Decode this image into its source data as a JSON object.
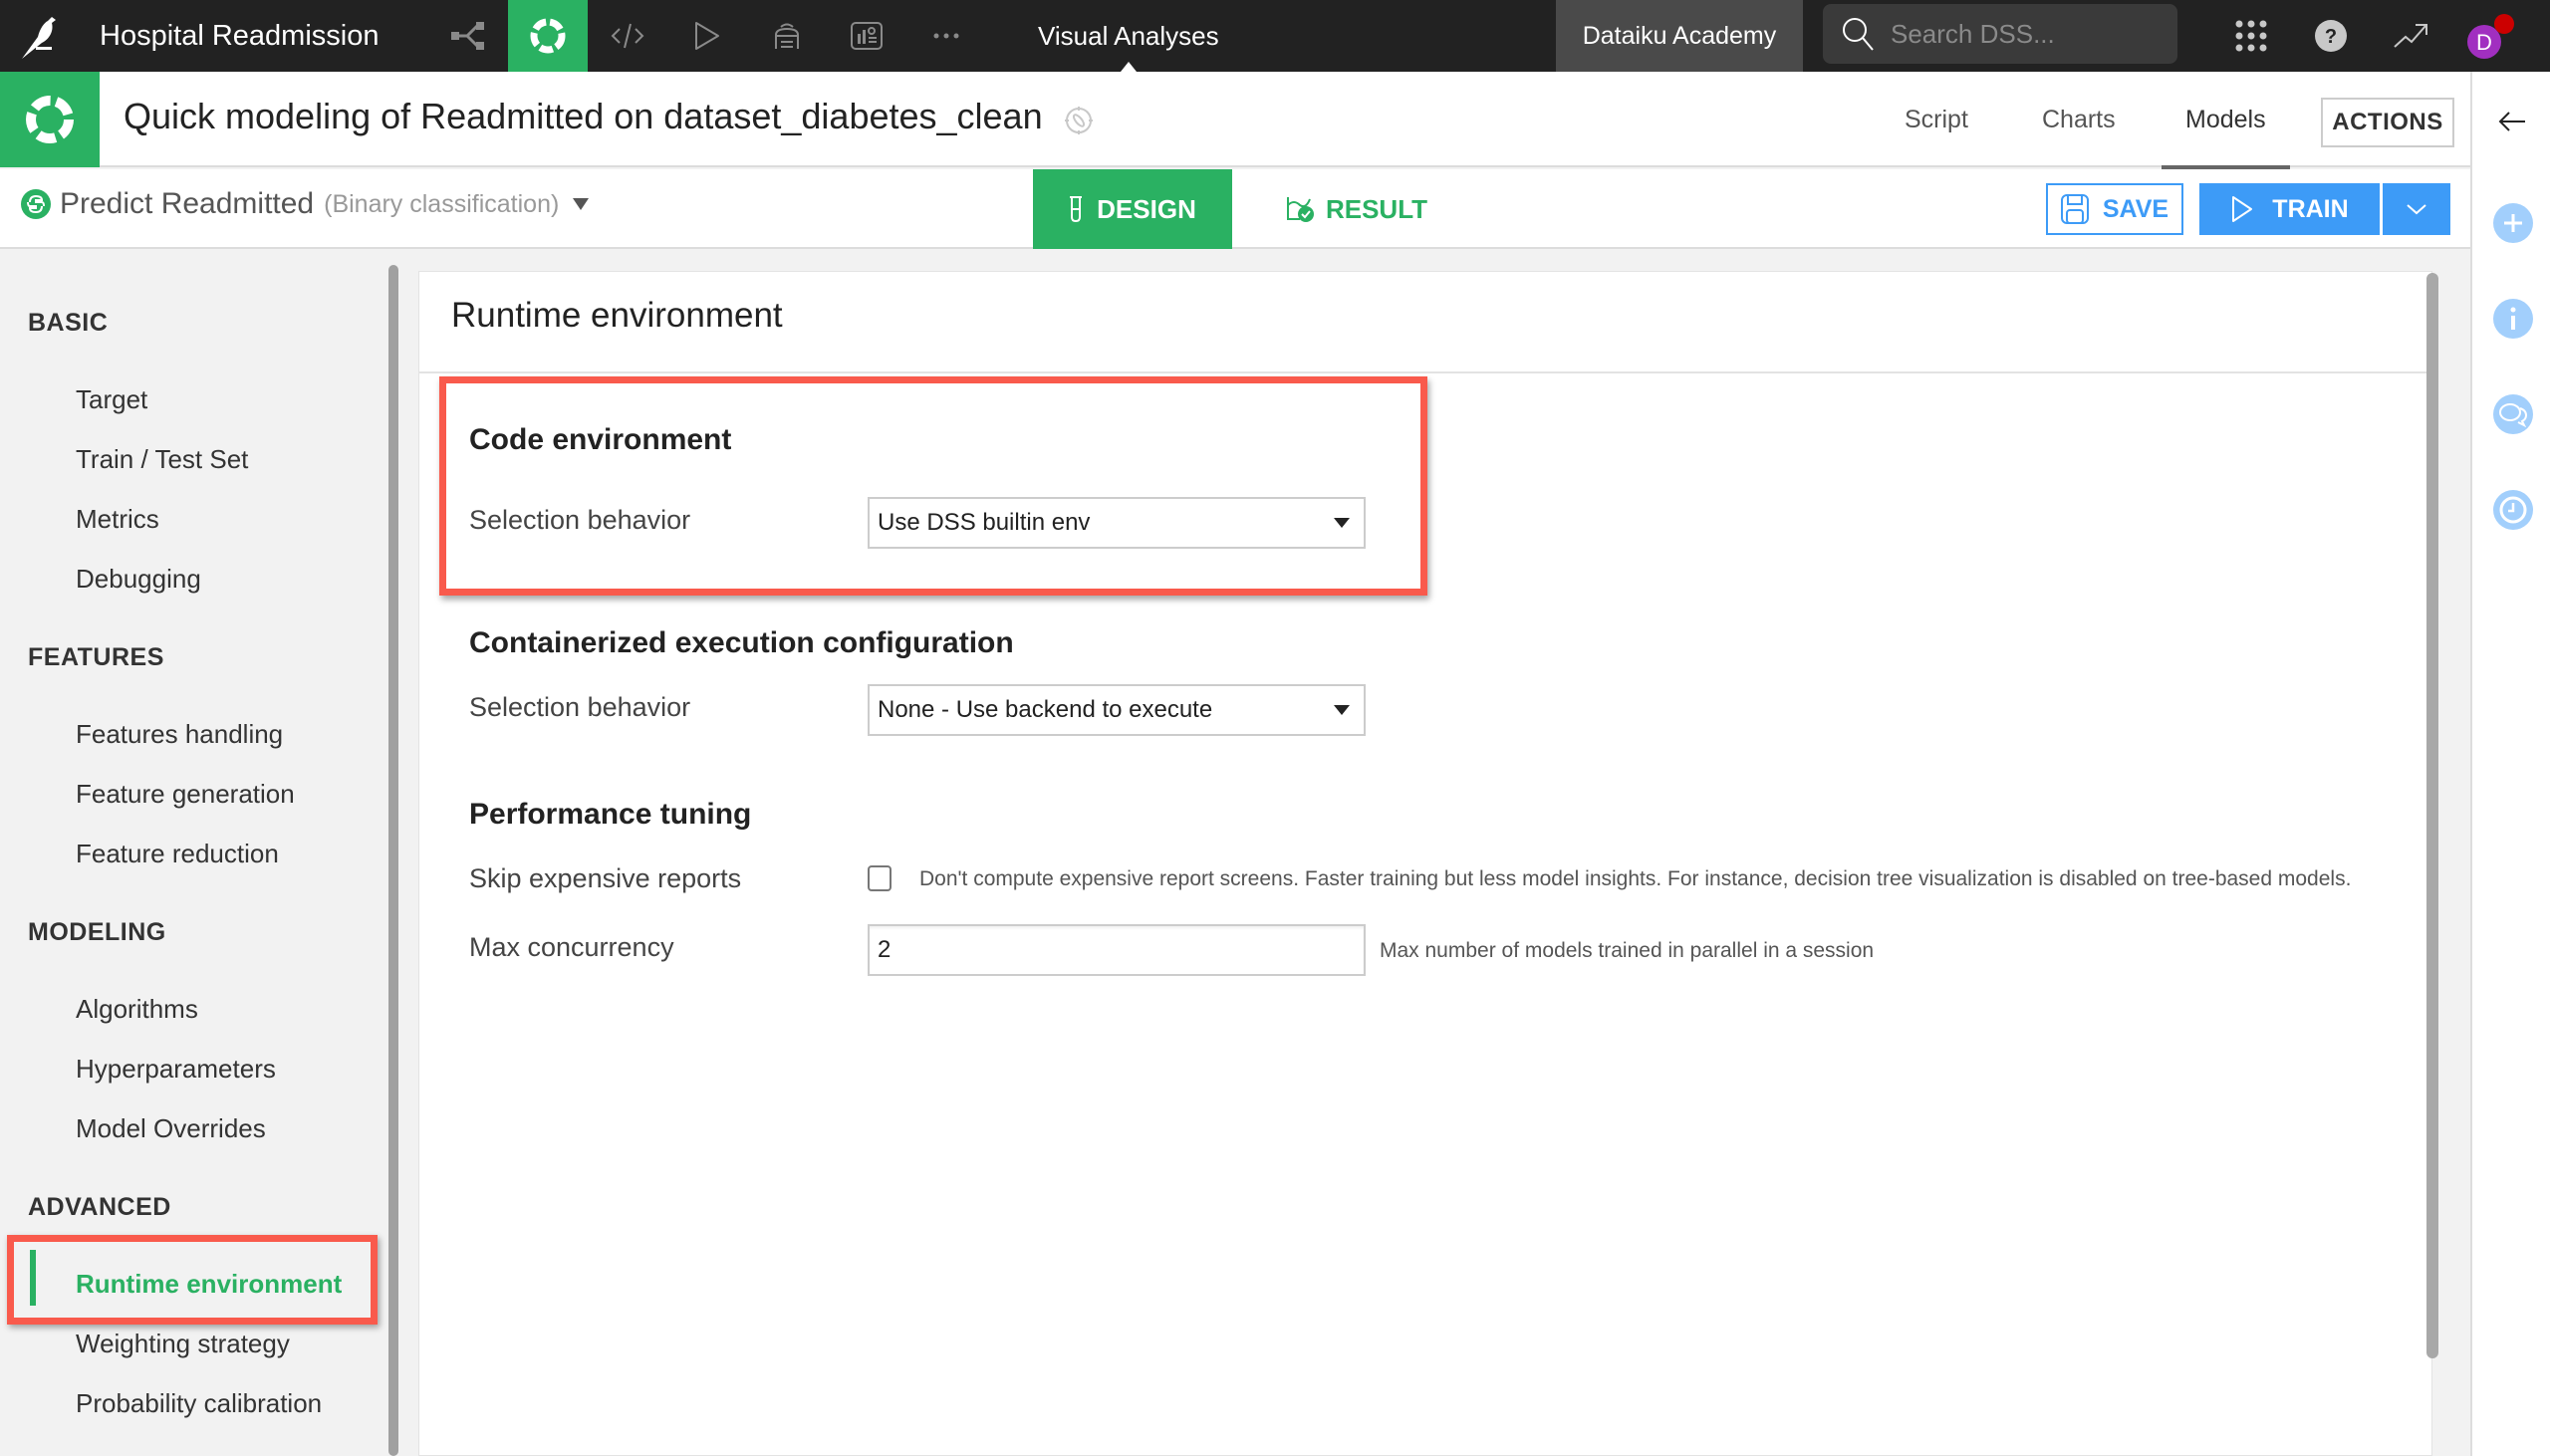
{
  "topnav": {
    "project_name": "Hospital Readmission",
    "section": "Visual Analyses",
    "instance": "Dataiku Academy",
    "search_placeholder": "Search DSS...",
    "icons": [
      "flow-icon",
      "analysis-icon",
      "code-icon",
      "run-icon",
      "datasets-stack-icon",
      "dashboard-icon",
      "more-icon"
    ],
    "right_icons": [
      "apps-grid-icon",
      "help-icon",
      "activity-trend-icon"
    ],
    "avatar_letter": "D",
    "colors": {
      "active_green": "#2ab162",
      "avatar": "#a12fc0",
      "notification": "#cc0000"
    }
  },
  "analysis": {
    "title": "Quick modeling of Readmitted on dataset_diabetes_clean",
    "tabs": [
      {
        "label": "Script",
        "active": false
      },
      {
        "label": "Charts",
        "active": false
      },
      {
        "label": "Models",
        "active": true
      }
    ],
    "actions_label": "ACTIONS"
  },
  "task": {
    "name": "Predict Readmitted",
    "type": "(Binary classification)",
    "design_label": "DESIGN",
    "result_label": "RESULT",
    "save_label": "SAVE",
    "train_label": "TRAIN"
  },
  "sidebar": {
    "sections": [
      {
        "title": "BASIC",
        "items": [
          "Target",
          "Train / Test Set",
          "Metrics",
          "Debugging"
        ]
      },
      {
        "title": "FEATURES",
        "items": [
          "Features handling",
          "Feature generation",
          "Feature reduction"
        ]
      },
      {
        "title": "MODELING",
        "items": [
          "Algorithms",
          "Hyperparameters",
          "Model Overrides"
        ]
      },
      {
        "title": "ADVANCED",
        "items": [
          "Runtime environment",
          "Weighting strategy",
          "Probability calibration"
        ]
      }
    ],
    "active_item": "Runtime environment"
  },
  "panel": {
    "title": "Runtime environment",
    "code_env": {
      "title": "Code environment",
      "label": "Selection behavior",
      "value": "Use DSS builtin env"
    },
    "container": {
      "title": "Containerized execution configuration",
      "label": "Selection behavior",
      "value": "None - Use backend to execute"
    },
    "performance": {
      "title": "Performance tuning",
      "skip_label": "Skip expensive reports",
      "skip_checked": false,
      "skip_help": "Don't compute expensive report screens. Faster training but less model insights. For instance, decision tree visualization is disabled on tree-based models.",
      "concurrency_label": "Max concurrency",
      "concurrency_value": "2",
      "concurrency_help": "Max number of models trained in parallel in a session"
    }
  },
  "rail": {
    "icons": [
      "back-arrow-icon",
      "add-icon",
      "info-icon",
      "discussions-icon",
      "history-clock-icon"
    ]
  }
}
